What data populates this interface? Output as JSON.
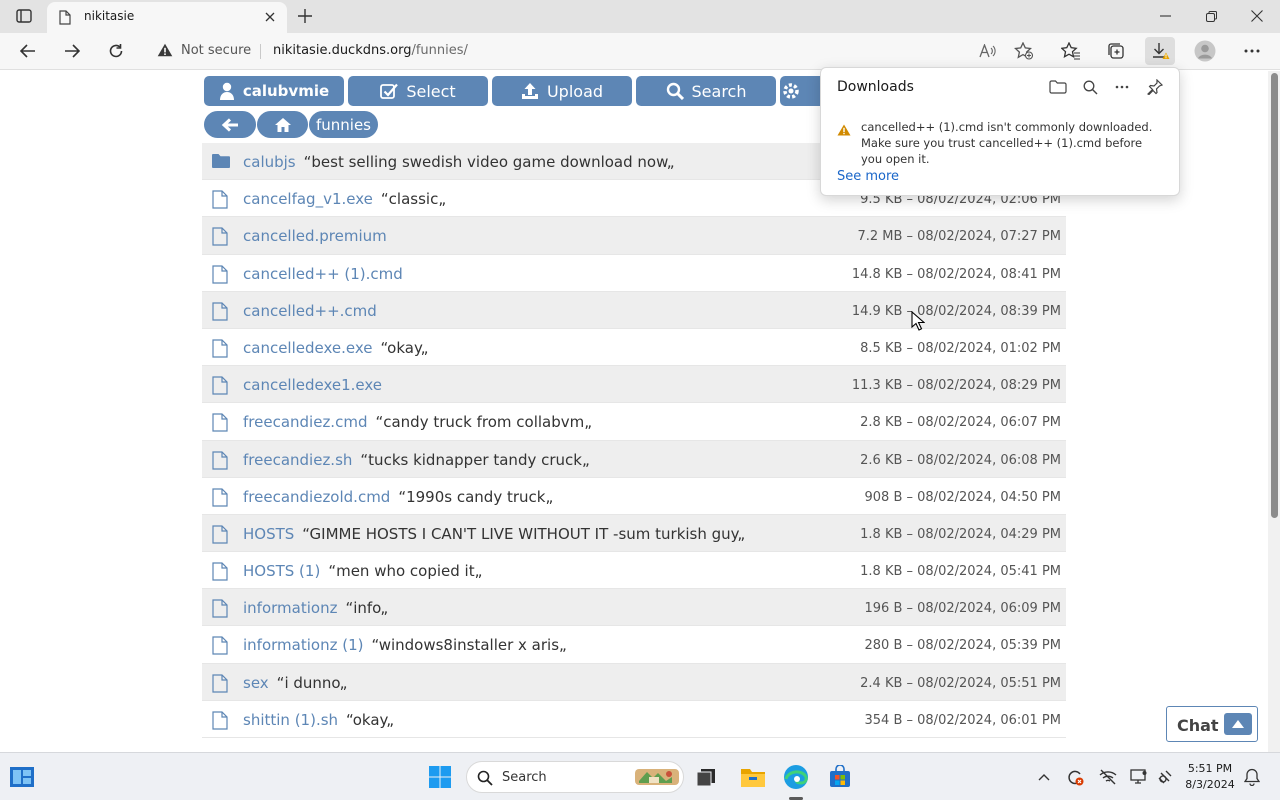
{
  "browser": {
    "tab_title": "nikitasie",
    "address": {
      "security_label": "Not secure",
      "url_host": "nikitasie.duckdns.org",
      "url_path": "/funnies/"
    }
  },
  "nav": {
    "user_label": "calubvmie",
    "select_label": "Select",
    "upload_label": "Upload",
    "search_label": "Search"
  },
  "breadcrumb": {
    "current": "funnies"
  },
  "files": [
    {
      "name": "calubjs",
      "comment": "“best selling swedish video game download now„",
      "meta": "",
      "type": "folder"
    },
    {
      "name": "cancelfag_v1.exe",
      "comment": "“classic„",
      "meta": "9.5 KB – 08/02/2024, 02:06 PM",
      "type": "file"
    },
    {
      "name": "cancelled.premium",
      "comment": "",
      "meta": "7.2 MB – 08/02/2024, 07:27 PM",
      "type": "file"
    },
    {
      "name": "cancelled++ (1).cmd",
      "comment": "",
      "meta": "14.8 KB – 08/02/2024, 08:41 PM",
      "type": "file"
    },
    {
      "name": "cancelled++.cmd",
      "comment": "",
      "meta": "14.9 KB – 08/02/2024, 08:39 PM",
      "type": "file"
    },
    {
      "name": "cancelledexe.exe",
      "comment": "“okay„",
      "meta": "8.5 KB – 08/02/2024, 01:02 PM",
      "type": "file"
    },
    {
      "name": "cancelledexe1.exe",
      "comment": "",
      "meta": "11.3 KB – 08/02/2024, 08:29 PM",
      "type": "file"
    },
    {
      "name": "freecandiez.cmd",
      "comment": "“candy truck from collabvm„",
      "meta": "2.8 KB – 08/02/2024, 06:07 PM",
      "type": "file"
    },
    {
      "name": "freecandiez.sh",
      "comment": "“tucks kidnapper tandy cruck„",
      "meta": "2.6 KB – 08/02/2024, 06:08 PM",
      "type": "file"
    },
    {
      "name": "freecandiezold.cmd",
      "comment": "“1990s candy truck„",
      "meta": "908 B – 08/02/2024, 04:50 PM",
      "type": "file"
    },
    {
      "name": "HOSTS",
      "comment": "“GIMME HOSTS I CAN'T LIVE WITHOUT IT -sum turkish guy„",
      "meta": "1.8 KB – 08/02/2024, 04:29 PM",
      "type": "file"
    },
    {
      "name": "HOSTS (1)",
      "comment": "“men who copied it„",
      "meta": "1.8 KB – 08/02/2024, 05:41 PM",
      "type": "file"
    },
    {
      "name": "informationz",
      "comment": "“info„",
      "meta": "196 B – 08/02/2024, 06:09 PM",
      "type": "file"
    },
    {
      "name": "informationz (1)",
      "comment": "“windows8installer x aris„",
      "meta": "280 B – 08/02/2024, 05:39 PM",
      "type": "file"
    },
    {
      "name": "sex",
      "comment": "“i dunno„",
      "meta": "2.4 KB – 08/02/2024, 05:51 PM",
      "type": "file"
    },
    {
      "name": "shittin (1).sh",
      "comment": "“okay„",
      "meta": "354 B – 08/02/2024, 06:01 PM",
      "type": "file"
    }
  ],
  "downloads": {
    "title": "Downloads",
    "message": "cancelled++ (1).cmd isn't commonly downloaded. Make sure you trust cancelled++ (1).cmd before you open it.",
    "see_more": "See more"
  },
  "chat": {
    "label": "Chat"
  },
  "taskbar": {
    "search_label": "Search",
    "time": "5:51 PM",
    "date": "8/3/2024"
  },
  "colors": {
    "accent": "#5d86b5",
    "row_alt": "#eeeeee",
    "link": "#1a66c9"
  }
}
